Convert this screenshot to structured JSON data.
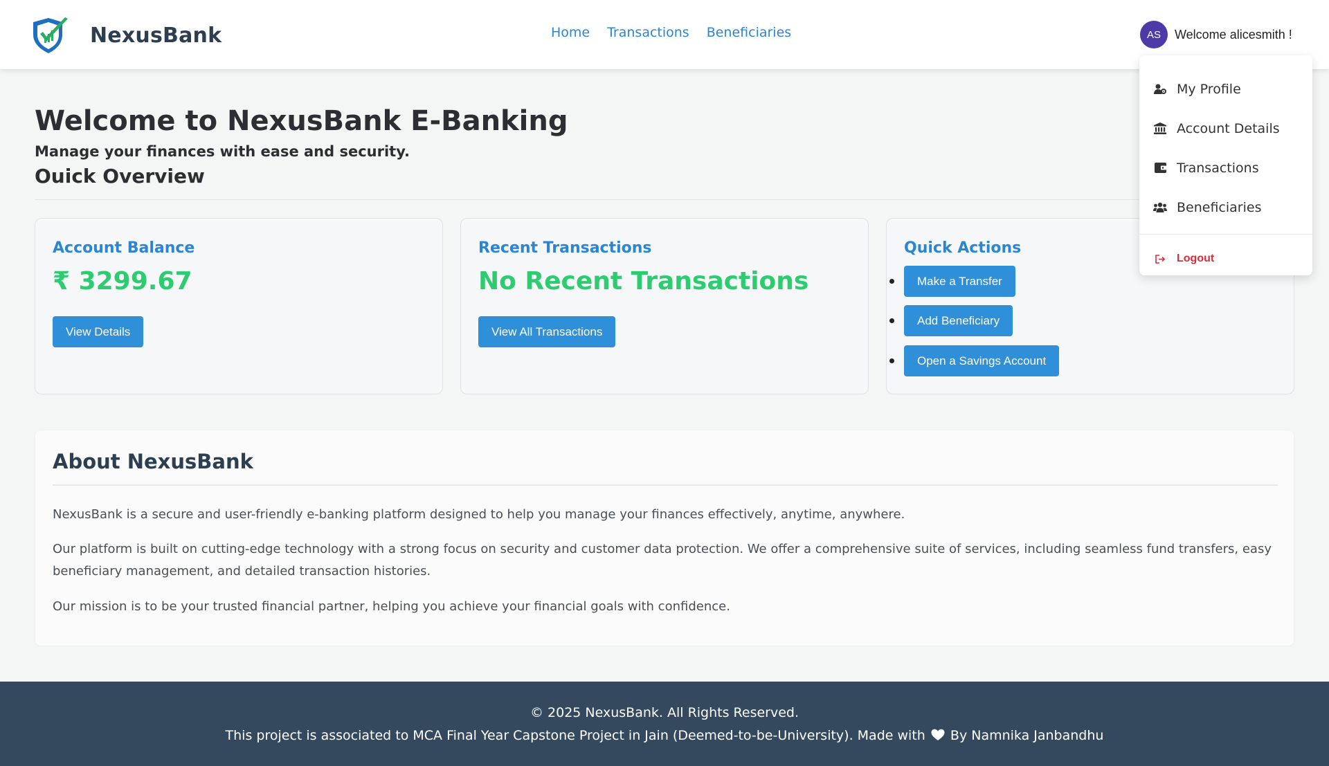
{
  "brand": {
    "name": "NexusBank",
    "logo_icon": "shield-check-logo"
  },
  "nav": {
    "links": [
      {
        "label": "Home"
      },
      {
        "label": "Transactions"
      },
      {
        "label": "Beneficiaries"
      }
    ]
  },
  "user": {
    "initials": "AS",
    "welcome": "Welcome alicesmith !"
  },
  "dropdown": {
    "items": [
      {
        "label": "My Profile",
        "icon": "user-gear-icon"
      },
      {
        "label": "Account Details",
        "icon": "bank-icon"
      },
      {
        "label": "Transactions",
        "icon": "wallet-icon"
      },
      {
        "label": "Beneficiaries",
        "icon": "users-icon"
      }
    ],
    "logout": {
      "label": "Logout",
      "icon": "logout-icon"
    }
  },
  "hero": {
    "title": "Welcome to NexusBank E-Banking",
    "subtitle": "Manage your finances with ease and security.",
    "overview_title": "Ouick Overview"
  },
  "cards": {
    "balance": {
      "title": "Account Balance",
      "value": "₹ 3299.67",
      "button": "View Details"
    },
    "recent": {
      "title": "Recent Transactions",
      "value": "No Recent Transactions",
      "button": "View All Transactions"
    },
    "quick": {
      "title": "Quick Actions",
      "actions": [
        "Make a Transfer",
        "Add Beneficiary",
        "Open a Savings Account"
      ]
    }
  },
  "about": {
    "title": "About NexusBank",
    "paragraphs": [
      "NexusBank is a secure and user-friendly e-banking platform designed to help you manage your finances effectively, anytime, anywhere.",
      "Our platform is built on cutting-edge technology with a strong focus on security and customer data protection. We offer a comprehensive suite of services, including seamless fund transfers, easy beneficiary management, and detailed transaction histories.",
      "Our mission is to be your trusted financial partner, helping you achieve your financial goals with confidence."
    ]
  },
  "footer": {
    "copyright": "© 2025 NexusBank. All Rights Reserved.",
    "credit_before": "This project is associated to MCA Final Year Capstone Project in Jain (Deemed-to-be-University). Made with",
    "credit_after": "By Namnika Janbandhu"
  },
  "colors": {
    "accent": "#2a86d4",
    "button": "#2f8fd8",
    "success": "#2ecc71",
    "footer_bg": "#34495e",
    "logout": "#d32f3b",
    "avatar": "#4e3aa6"
  }
}
